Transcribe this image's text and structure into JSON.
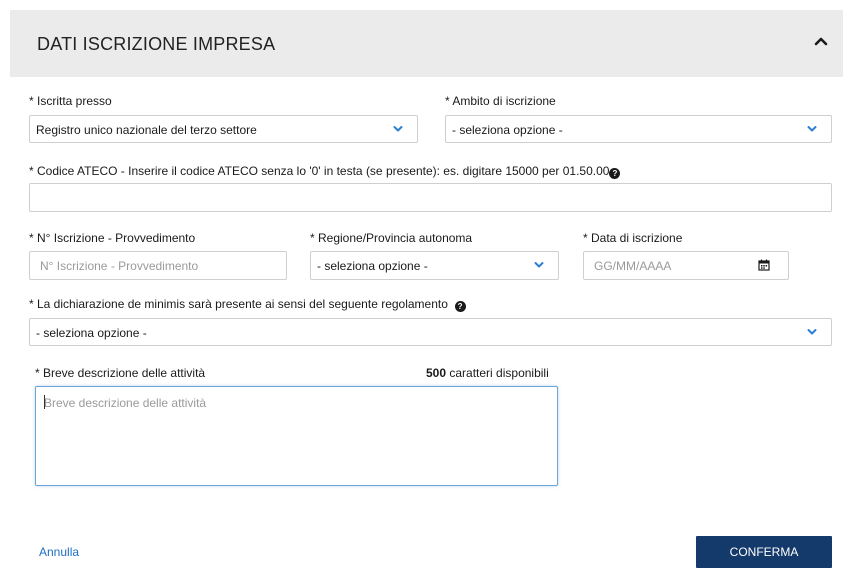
{
  "header": {
    "title": "DATI ISCRIZIONE IMPRESA",
    "toggle_icon": "chevron-up-icon"
  },
  "fields": {
    "iscritta_presso": {
      "label": "* Iscritta presso",
      "value": "Registro unico nazionale del terzo settore"
    },
    "ambito": {
      "label": "* Ambito di iscrizione",
      "value": "- seleziona opzione -"
    },
    "ateco": {
      "label": "* Codice ATECO - Inserire il codice ATECO senza lo '0' in testa (se presente): es. digitare 15000 per 01.50.00",
      "value": ""
    },
    "n_iscrizione": {
      "label": "* N° Iscrizione - Provvedimento",
      "placeholder": "N° Iscrizione - Provvedimento"
    },
    "regione": {
      "label": "* Regione/Provincia autonoma",
      "value": "- seleziona opzione -"
    },
    "data_iscrizione": {
      "label": "* Data di iscrizione",
      "placeholder": "GG/MM/AAAA"
    },
    "de_minimis": {
      "label": "* La dichiarazione de minimis sarà presente ai sensi del seguente regolamento",
      "value": "- seleziona opzione -"
    },
    "descrizione": {
      "label": "* Breve descrizione delle attività",
      "placeholder": "Breve descrizione delle attività",
      "counter_number": "500",
      "counter_text": "caratteri disponibili"
    }
  },
  "footer": {
    "cancel_label": "Annulla",
    "confirm_label": "CONFERMA"
  },
  "colors": {
    "accent": "#143a6b",
    "link": "#1e6fc4",
    "chevron": "#2a7fd4"
  }
}
